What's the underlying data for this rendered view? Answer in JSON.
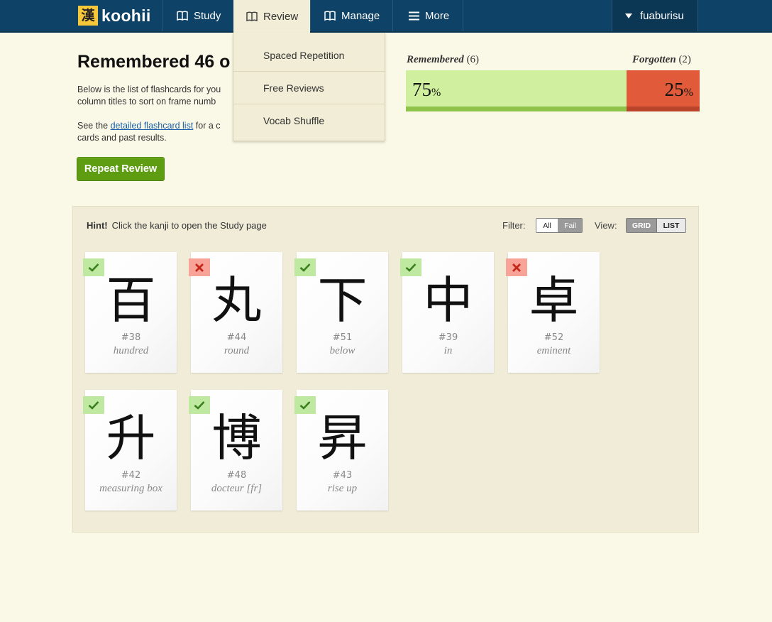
{
  "nav": {
    "logo_mark": "漢",
    "logo_text": "koohii",
    "study": "Study",
    "review": "Review",
    "manage": "Manage",
    "more": "More",
    "user": "fuaburisu"
  },
  "dropdown": [
    "Spaced Repetition",
    "Free Reviews",
    "Vocab Shuffle"
  ],
  "heading": {
    "title": "Remembered 46 o",
    "p1": "Below is the list of flashcards for you column titles to sort on frame numb",
    "p2_pre": "See the ",
    "p2_link": "detailed flashcard list",
    "p2_post": " for a c cards and past results.",
    "repeat_button": "Repeat Review"
  },
  "score": {
    "remembered_label": "Remembered",
    "remembered_count": "(6)",
    "forgotten_label": "Forgotten",
    "forgotten_count": "(2)",
    "remembered_pct": "75",
    "forgotten_pct": "25",
    "pct_sign": "%",
    "remembered_fraction": 0.75,
    "colors": {
      "remembered": "#d0f0a0",
      "forgotten": "#e15b3a"
    }
  },
  "panel": {
    "hint_bold": "Hint!",
    "hint_text": "Click the kanji to open the Study page",
    "filter_label": "Filter:",
    "filter_options": [
      "All",
      "Fail"
    ],
    "view_label": "View:",
    "view_options": [
      "GRID",
      "LIST"
    ]
  },
  "cards": [
    {
      "kanji": "百",
      "num": "#38",
      "keyword": "hundred",
      "status": "pass"
    },
    {
      "kanji": "丸",
      "num": "#44",
      "keyword": "round",
      "status": "fail"
    },
    {
      "kanji": "下",
      "num": "#51",
      "keyword": "below",
      "status": "pass"
    },
    {
      "kanji": "中",
      "num": "#39",
      "keyword": "in",
      "status": "pass"
    },
    {
      "kanji": "卓",
      "num": "#52",
      "keyword": "eminent",
      "status": "fail"
    },
    {
      "kanji": "升",
      "num": "#42",
      "keyword": "measuring box",
      "status": "pass"
    },
    {
      "kanji": "博",
      "num": "#48",
      "keyword": "docteur [fr]",
      "status": "pass"
    },
    {
      "kanji": "昇",
      "num": "#43",
      "keyword": "rise up",
      "status": "pass"
    }
  ]
}
